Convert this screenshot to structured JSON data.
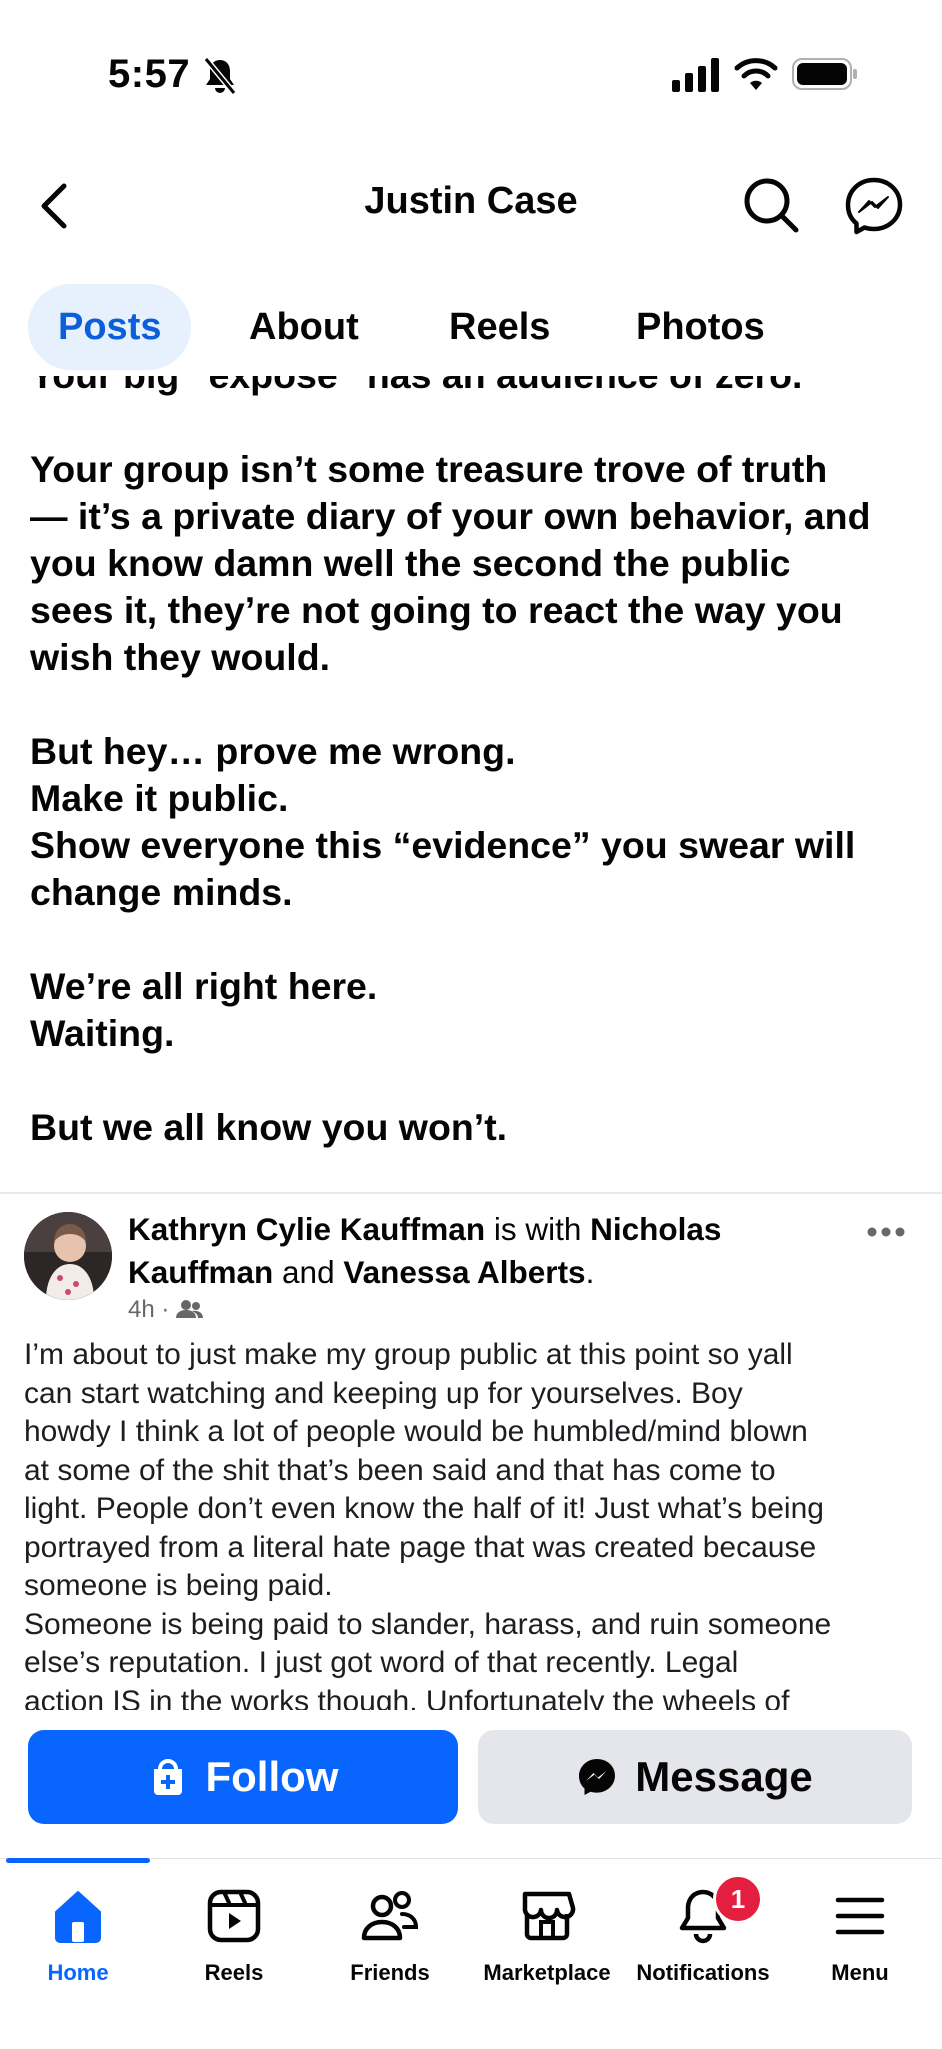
{
  "status_bar": {
    "time": "5:57"
  },
  "header": {
    "title": "Justin Case"
  },
  "tabs": [
    {
      "label": "Posts"
    },
    {
      "label": "About"
    },
    {
      "label": "Reels"
    },
    {
      "label": "Photos"
    }
  ],
  "prev_post": {
    "lines": [
      "Your big “exposé” has an audience of zero.",
      "Your group isn’t some treasure trove of truth",
      "— it’s a private diary of your own behavior, and",
      "you know damn well the second the public",
      "sees it, they’re not going to react the way you",
      "wish they would.",
      "But hey… prove me wrong.",
      "Make it public.",
      "Show everyone this “evidence” you swear will",
      "change minds.",
      "We’re all right here.",
      "Waiting.",
      "But we all know you won’t."
    ]
  },
  "feed_post": {
    "author": "Kathryn Cylie Kauffman",
    "with_text": "is with",
    "tagged_1": "Nicholas Kauffman",
    "and_text": "and",
    "tagged_2": "Vanessa Alberts",
    "time": "4h",
    "lines": [
      "I’m about to just make my group public at this point so yall",
      "can start watching and keeping up for yourselves. Boy",
      "howdy I think a lot of people would be humbled/mind blown",
      "at some of the shit that’s been said and that has come to",
      "light. People don’t even know the half of it! Just what’s being",
      "portrayed from a literal hate page that was created because",
      "someone is being paid.",
      "Someone is being paid to slander, harass, and ruin someone",
      "else’s reputation. I just got word of that recently. Legal",
      "action IS in the works though. Unfortunately the wheels of"
    ]
  },
  "actions": {
    "follow": "Follow",
    "message": "Message"
  },
  "nav": {
    "items": [
      {
        "label": "Home"
      },
      {
        "label": "Reels"
      },
      {
        "label": "Friends"
      },
      {
        "label": "Marketplace"
      },
      {
        "label": "Notifications"
      },
      {
        "label": "Menu"
      }
    ],
    "notifications_badge": "1"
  },
  "colors": {
    "accent": "#0866ff",
    "tab_active_bg": "#e7f0fd",
    "badge": "#e41e3f"
  }
}
